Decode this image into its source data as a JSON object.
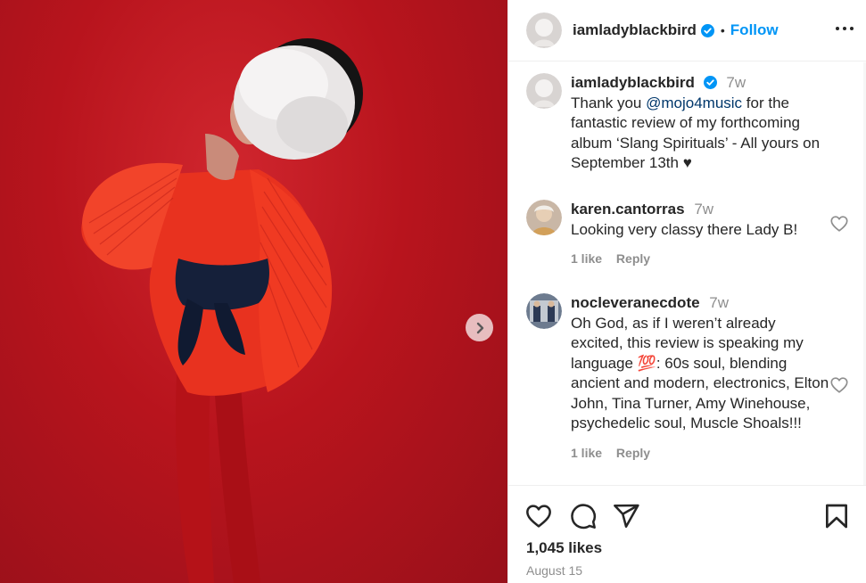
{
  "post": {
    "author": "iamladyblackbird",
    "follow_label": "Follow",
    "separator": "•",
    "caption_time": "7w",
    "caption_prefix": "Thank you ",
    "caption_mention": "@mojo4music",
    "caption_suffix": " for the fantastic review of my forthcoming album ‘Slang Spirituals’ - All yours on September 13th ♥",
    "likes": "1,045 likes",
    "date": "August 15"
  },
  "comments": [
    {
      "username": "karen.cantorras",
      "time": "7w",
      "text": "Looking very classy there Lady B!",
      "likes": "1 like",
      "reply": "Reply"
    },
    {
      "username": "nocleveranecdote",
      "time": "7w",
      "text": "Oh God, as if I weren’t already excited, this review is speaking my language 💯: 60s soul, blending ancient and modern, electronics, Elton John, Tina Turner, Amy Winehouse, psychedelic soul, Muscle Shoals!!!",
      "likes": "1 like",
      "reply": "Reply"
    }
  ],
  "icons": {
    "verified": "verified-badge-icon",
    "more": "more-options-icon",
    "next": "chevron-right-icon",
    "like": "heart-icon",
    "comment": "comment-icon",
    "share": "send-icon",
    "save": "bookmark-icon"
  },
  "colors": {
    "accent": "#0095f6",
    "verified": "#0095f6",
    "mention": "#00376b",
    "muted": "#8e8e8e",
    "photo_background": "#b8141d"
  }
}
